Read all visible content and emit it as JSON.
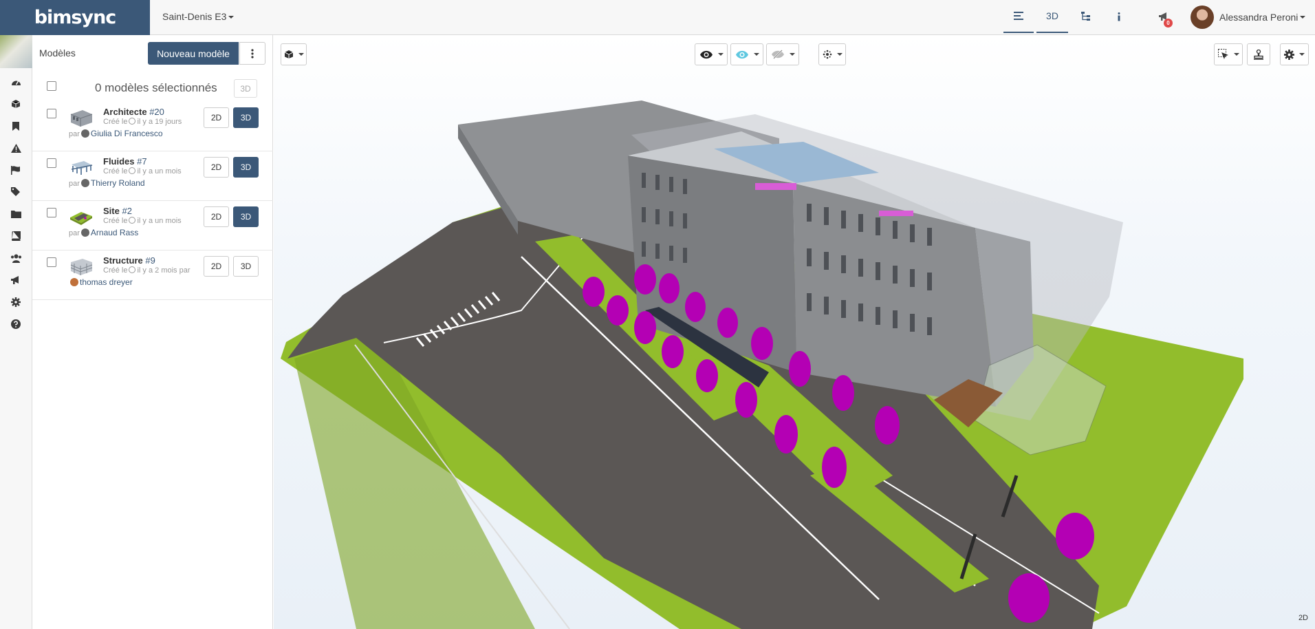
{
  "app": {
    "logo_text": "bimsync",
    "project": "Saint-Denis E3"
  },
  "topnav": {
    "tab_3d": "3D",
    "notification_count": "0",
    "user_name": "Alessandra Peroni"
  },
  "panel": {
    "title": "Modèles",
    "new_model_label": "Nouveau modèle",
    "selected_count": "0 modèles sélectionnés",
    "bulk_3d": "3D"
  },
  "models": [
    {
      "name": "Architecte",
      "num": "#20",
      "created": "Créé le",
      "ago": "il y a 19 jours",
      "by_label": "par",
      "author": "Giulia Di Francesco",
      "btn_2d": "2D",
      "btn_3d": "3D",
      "active_3d": true
    },
    {
      "name": "Fluides",
      "num": "#7",
      "created": "Créé le",
      "ago": "il y a un mois",
      "by_label": "par",
      "author": "Thierry Roland",
      "btn_2d": "2D",
      "btn_3d": "3D",
      "active_3d": true
    },
    {
      "name": "Site",
      "num": "#2",
      "created": "Créé le",
      "ago": "il y a un mois",
      "by_label": "par",
      "author": "Arnaud Rass",
      "btn_2d": "2D",
      "btn_3d": "3D",
      "active_3d": true
    },
    {
      "name": "Structure",
      "num": "#9",
      "created": "Créé le",
      "ago": "il y a 2 mois",
      "by_label": "par",
      "author": "thomas dreyer",
      "btn_2d": "2D",
      "btn_3d": "3D",
      "active_3d": false
    }
  ],
  "viewer": {
    "corner_label": "2D"
  },
  "icons": {
    "rail": [
      "dashboard-icon",
      "cube-icon",
      "bookmark-icon",
      "warning-icon",
      "flag-icon",
      "tags-icon",
      "folder-icon",
      "book-icon",
      "users-icon",
      "megaphone-icon",
      "gear-icon",
      "help-icon"
    ],
    "toolbar": [
      "cube-view-icon",
      "eye-icon",
      "eye-highlight-icon",
      "eye-slash-icon",
      "explode-icon",
      "cursor-icon",
      "stamp-icon",
      "settings-icon"
    ]
  },
  "colors": {
    "brand": "#3b5878",
    "ground": "#92bd2c",
    "road": "#5b5755",
    "trees": "#b400b4",
    "building": "#8b8d90"
  }
}
